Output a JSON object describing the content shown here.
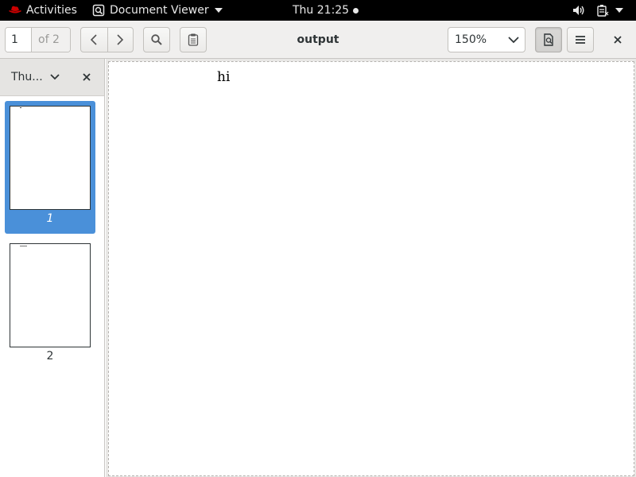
{
  "topbar": {
    "activities": "Activities",
    "app_menu": "Document Viewer",
    "clock": "Thu 21:25"
  },
  "header": {
    "page_number": "1",
    "page_of": "of 2",
    "title": "output",
    "zoom": "150%"
  },
  "sidebar": {
    "mode_label": "Thu...",
    "thumbnails": [
      {
        "label": "1",
        "selected": true
      },
      {
        "label": "2",
        "selected": false
      }
    ]
  },
  "document": {
    "text": "hi"
  },
  "colors": {
    "selection": "#4a90d9",
    "topbar_bg": "#000000",
    "header_bg": "#f0efee"
  },
  "icons": [
    "redhat-icon",
    "document-viewer-icon",
    "chevron-down-icon",
    "volume-icon",
    "battery-icon",
    "go-previous-icon",
    "go-next-icon",
    "search-icon",
    "annotations-icon",
    "page-icon",
    "hamburger-menu-icon",
    "close-icon"
  ]
}
